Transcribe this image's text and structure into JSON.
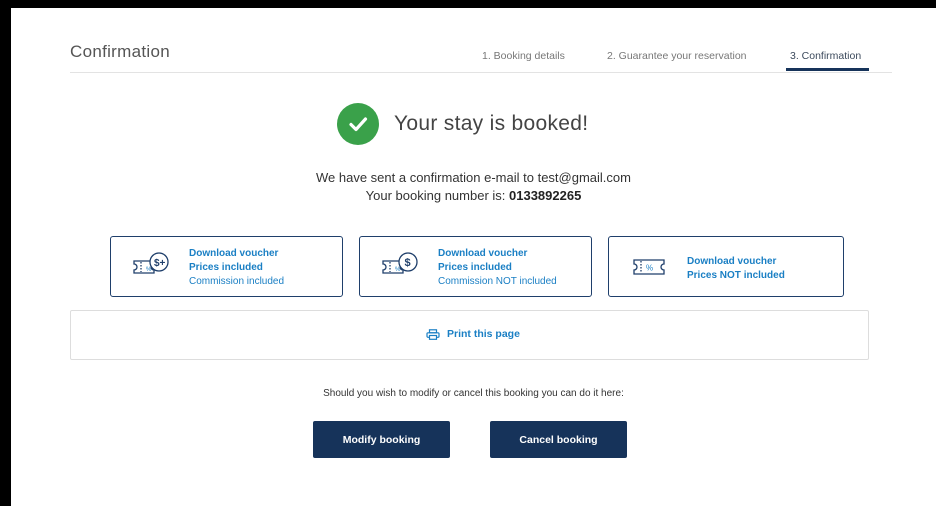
{
  "header": {
    "title": "Confirmation",
    "steps": [
      {
        "label": "1. Booking details"
      },
      {
        "label": "2. Guarantee your reservation"
      },
      {
        "label": "3. Confirmation"
      }
    ]
  },
  "success": {
    "message": "Your stay is booked!"
  },
  "confirmation": {
    "email_line": "We have sent a confirmation e-mail to test@gmail.com",
    "booking_label": "Your booking number is: ",
    "booking_number": "0133892265"
  },
  "vouchers": [
    {
      "icon": "voucher-dollar-plus-icon",
      "title": "Download voucher",
      "prices": "Prices included",
      "commission": "Commission included"
    },
    {
      "icon": "voucher-dollar-icon",
      "title": "Download voucher",
      "prices": "Prices included",
      "commission": "Commission NOT included"
    },
    {
      "icon": "voucher-percent-icon",
      "title": "Download voucher",
      "prices": "Prices NOT included"
    }
  ],
  "print": {
    "label": "Print this page",
    "icon": "printer-icon"
  },
  "modify": {
    "note": "Should you wish to modify or cancel this booking you can do it here:",
    "modify_label": "Modify booking",
    "cancel_label": "Cancel booking"
  },
  "colors": {
    "accent": "#1a7fc4",
    "primary_button": "#16335a",
    "success": "#3aa14a"
  }
}
